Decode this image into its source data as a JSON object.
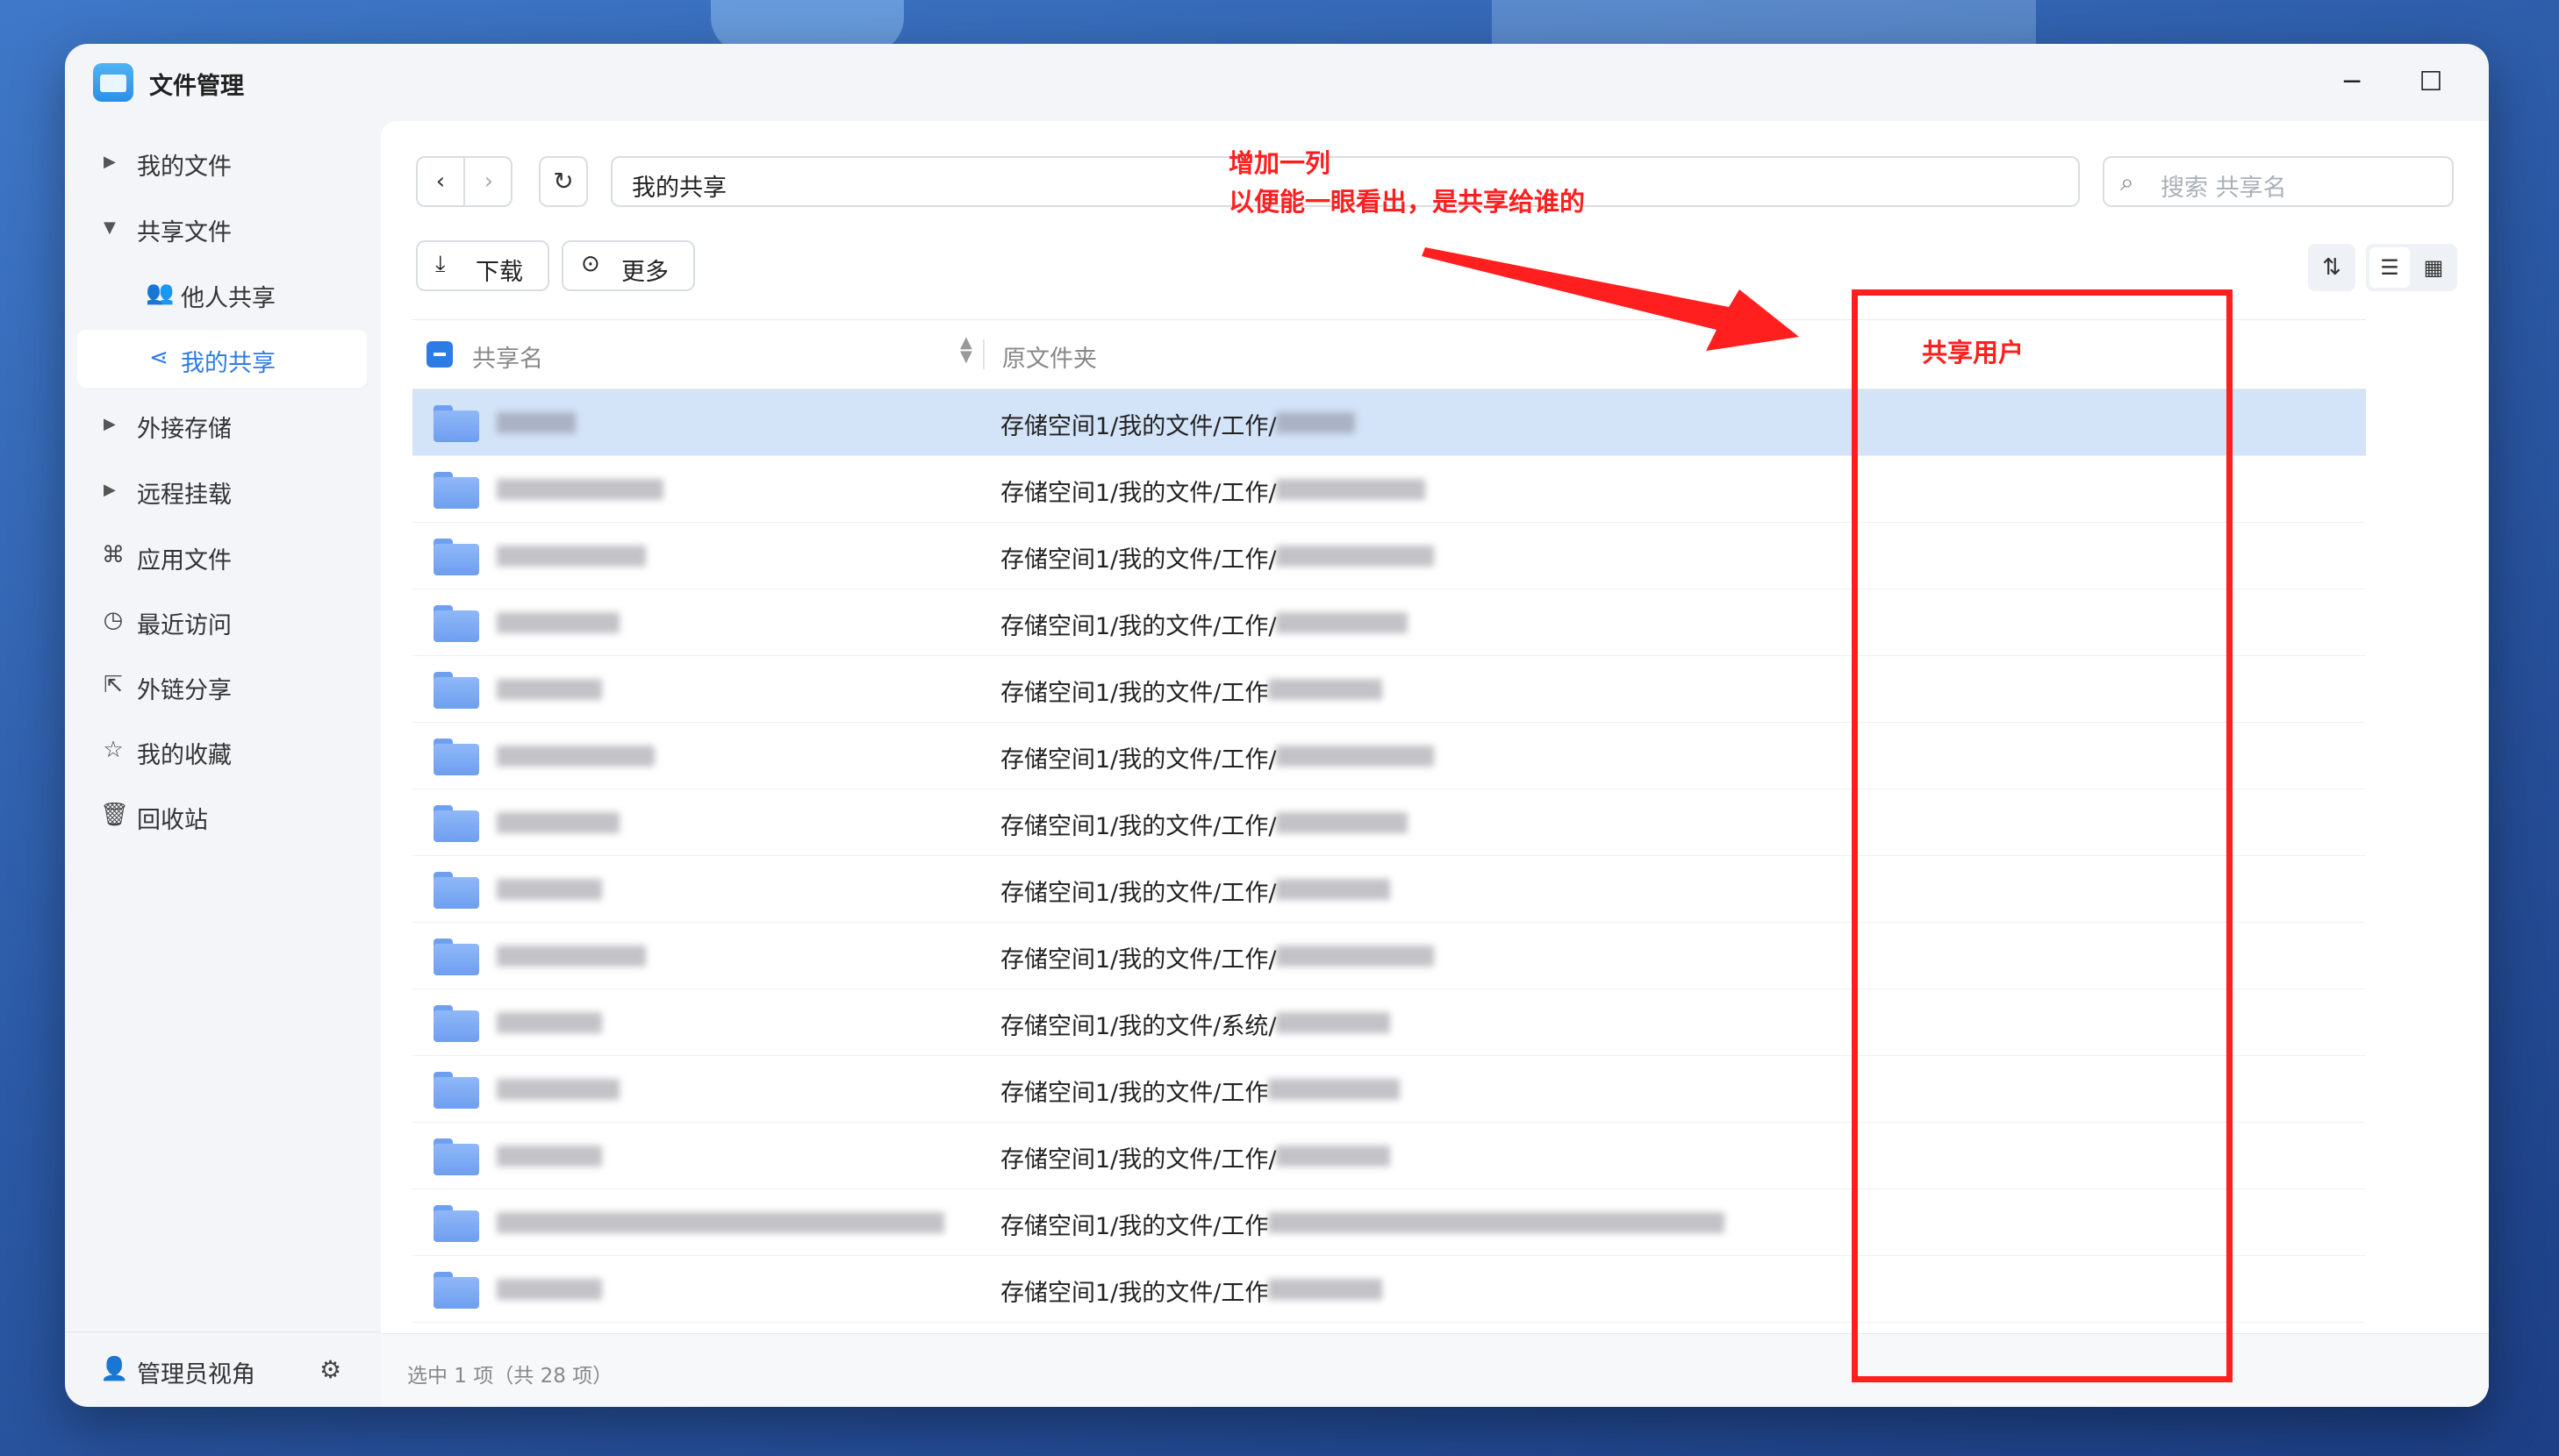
{
  "window": {
    "title": "文件管理",
    "controls": {
      "minimize": "─",
      "maximize": "☐",
      "close": "✕"
    }
  },
  "sidebar": {
    "items": [
      {
        "label": "我的文件",
        "icon": "caret-right-icon"
      },
      {
        "label": "共享文件",
        "icon": "caret-down-icon"
      },
      {
        "label": "他人共享",
        "icon": "users-icon"
      },
      {
        "label": "我的共享",
        "icon": "share-icon",
        "active": true
      },
      {
        "label": "外接存储",
        "icon": "caret-right-icon"
      },
      {
        "label": "远程挂载",
        "icon": "caret-right-icon"
      },
      {
        "label": "应用文件",
        "icon": "apps-icon"
      },
      {
        "label": "最近访问",
        "icon": "clock-icon"
      },
      {
        "label": "外链分享",
        "icon": "external-share-icon"
      },
      {
        "label": "我的收藏",
        "icon": "star-icon"
      },
      {
        "label": "回收站",
        "icon": "trash-icon"
      }
    ],
    "footer": {
      "label": "管理员视角",
      "icon": "admin-user-icon",
      "settings_icon": "gear-icon"
    }
  },
  "toolbar": {
    "back": "‹",
    "forward": "›",
    "refresh": "↻",
    "path": "我的共享",
    "search_placeholder": "搜索 共享名",
    "download_label": "下载",
    "more_label": "更多"
  },
  "table": {
    "columns": {
      "name": "共享名",
      "folder": "原文件夹"
    },
    "rows": [
      {
        "path": "存储空间1/我的文件/工作/",
        "selected": true
      },
      {
        "path": "存储空间1/我的文件/工作/"
      },
      {
        "path": "存储空间1/我的文件/工作/"
      },
      {
        "path": "存储空间1/我的文件/工作/"
      },
      {
        "path": "存储空间1/我的文件/工作"
      },
      {
        "path": "存储空间1/我的文件/工作/"
      },
      {
        "path": "存储空间1/我的文件/工作/"
      },
      {
        "path": "存储空间1/我的文件/工作/"
      },
      {
        "path": "存储空间1/我的文件/工作/"
      },
      {
        "path": "存储空间1/我的文件/系统/"
      },
      {
        "path": "存储空间1/我的文件/工作"
      },
      {
        "path": "存储空间1/我的文件/工作/"
      },
      {
        "path": "存储空间1/我的文件/工作"
      },
      {
        "path": "存储空间1/我的文件/工作"
      }
    ]
  },
  "status": {
    "text": "选中 1 项（共 28 项）"
  },
  "annotation": {
    "line1": "增加一列",
    "line2": "以便能一眼看出，是共享给谁的",
    "column_label": "共享用户",
    "color": "#ff1f1f"
  }
}
